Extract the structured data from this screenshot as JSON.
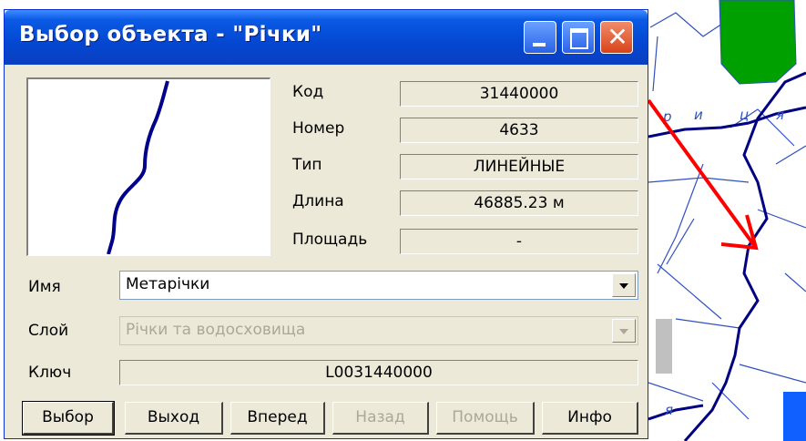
{
  "window": {
    "title": "Выбор объекта - \"Річки\""
  },
  "titlebar_buttons": [
    {
      "name": "minimize",
      "icon": "minimize-icon"
    },
    {
      "name": "maximize",
      "icon": "maximize-icon"
    },
    {
      "name": "close",
      "icon": "close-icon",
      "glyph": "✕"
    }
  ],
  "properties": {
    "code": {
      "label": "Код",
      "value": "31440000"
    },
    "number": {
      "label": "Номер",
      "value": "4633"
    },
    "type": {
      "label": "Тип",
      "value": "ЛИНЕЙНЫЕ"
    },
    "length": {
      "label": "Длина",
      "value": "46885.23  м"
    },
    "area": {
      "label": "Площадь",
      "value": "-"
    }
  },
  "form": {
    "name": {
      "label": "Имя",
      "value": "Метарічки"
    },
    "layer": {
      "label": "Слой",
      "value": "Річки та водосховища"
    },
    "key": {
      "label": "Ключ",
      "value": "L0031440000"
    }
  },
  "buttons": {
    "select": "Выбор",
    "exit": "Выход",
    "forward": "Вперед",
    "back": "Назад",
    "help": "Помощь",
    "info": "Инфо"
  },
  "map": {
    "labels": [
      "р",
      "и",
      "ц",
      "я",
      "я"
    ],
    "colors": {
      "park": "#00a000",
      "river": "#000080",
      "arrow": "#ff0000",
      "building": "#c0c0c0",
      "water": "#0066ff"
    }
  }
}
